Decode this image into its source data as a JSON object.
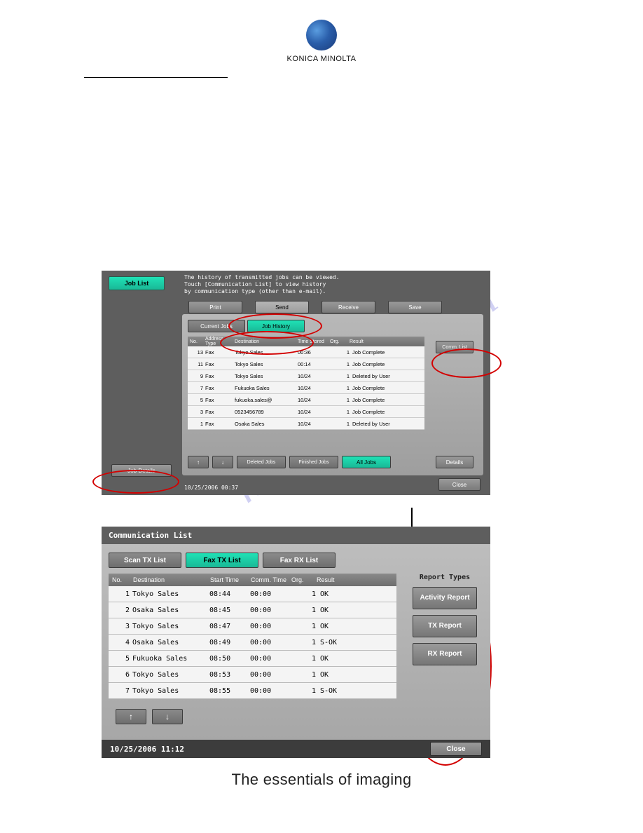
{
  "logo_text": "KONICA MINOLTA",
  "tagline": "The essentials of imaging",
  "watermark": "manualslib.com",
  "screen1": {
    "job_list_btn": "Job List",
    "message": "The history of transmitted jobs can be viewed.\nTouch [Communication List] to view history\nby communication type (other than e-mail).",
    "main_tabs": [
      "Print",
      "Send",
      "Receive",
      "Save"
    ],
    "selected_main_tab": "Send",
    "sub_tabs": [
      "Current Jobs",
      "Job History"
    ],
    "active_sub_tab": "Job History",
    "columns": [
      "No.",
      "Address Type",
      "Destination",
      "Time Stored",
      "Org.",
      "Result"
    ],
    "rows": [
      {
        "no": "13",
        "type": "Fax",
        "dest": "Tokyo Sales",
        "time": "00:36",
        "org": "1",
        "result": "Job Complete"
      },
      {
        "no": "11",
        "type": "Fax",
        "dest": "Tokyo Sales",
        "time": "00:14",
        "org": "1",
        "result": "Job Complete"
      },
      {
        "no": "9",
        "type": "Fax",
        "dest": "Tokyo Sales",
        "time": "10/24",
        "org": "1",
        "result": "Deleted by User"
      },
      {
        "no": "7",
        "type": "Fax",
        "dest": "Fukuoka Sales",
        "time": "10/24",
        "org": "1",
        "result": "Job Complete"
      },
      {
        "no": "5",
        "type": "Fax",
        "dest": "fukuoka.sales@",
        "time": "10/24",
        "org": "1",
        "result": "Job Complete"
      },
      {
        "no": "3",
        "type": "Fax",
        "dest": "0523456789",
        "time": "10/24",
        "org": "1",
        "result": "Job Complete"
      },
      {
        "no": "1",
        "type": "Fax",
        "dest": "Osaka Sales",
        "time": "10/24",
        "org": "1",
        "result": "Deleted by User"
      }
    ],
    "comm_list_btn": "Comm. List",
    "bottom_buttons": {
      "deleted": "Deleted Jobs",
      "finished": "Finished Jobs",
      "all": "All Jobs"
    },
    "details_btn": "Details",
    "job_details_btn": "Job Details",
    "close_btn": "Close",
    "timestamp": "10/25/2006   00:37"
  },
  "screen2": {
    "title": "Communication List",
    "tabs": [
      "Scan TX List",
      "Fax TX List",
      "Fax RX List"
    ],
    "active_tab": "Fax TX List",
    "columns": [
      "No.",
      "Destination",
      "Start Time",
      "Comm. Time",
      "Org.",
      "Result"
    ],
    "rows": [
      {
        "no": "1",
        "dest": "Tokyo Sales",
        "start": "08:44",
        "comm": "00:00",
        "org": "1",
        "result": "OK"
      },
      {
        "no": "2",
        "dest": "Osaka Sales",
        "start": "08:45",
        "comm": "00:00",
        "org": "1",
        "result": "OK"
      },
      {
        "no": "3",
        "dest": "Tokyo Sales",
        "start": "08:47",
        "comm": "00:00",
        "org": "1",
        "result": "OK"
      },
      {
        "no": "4",
        "dest": "Osaka Sales",
        "start": "08:49",
        "comm": "00:00",
        "org": "1",
        "result": "S-OK"
      },
      {
        "no": "5",
        "dest": "Fukuoka Sales",
        "start": "08:50",
        "comm": "00:00",
        "org": "1",
        "result": "OK"
      },
      {
        "no": "6",
        "dest": "Tokyo Sales",
        "start": "08:53",
        "comm": "00:00",
        "org": "1",
        "result": "OK"
      },
      {
        "no": "7",
        "dest": "Tokyo Sales",
        "start": "08:55",
        "comm": "00:00",
        "org": "1",
        "result": "S-OK"
      }
    ],
    "report_title": "Report Types",
    "report_buttons": [
      "Activity Report",
      "TX Report",
      "RX Report"
    ],
    "close_btn": "Close",
    "timestamp": "10/25/2006   11:12"
  }
}
